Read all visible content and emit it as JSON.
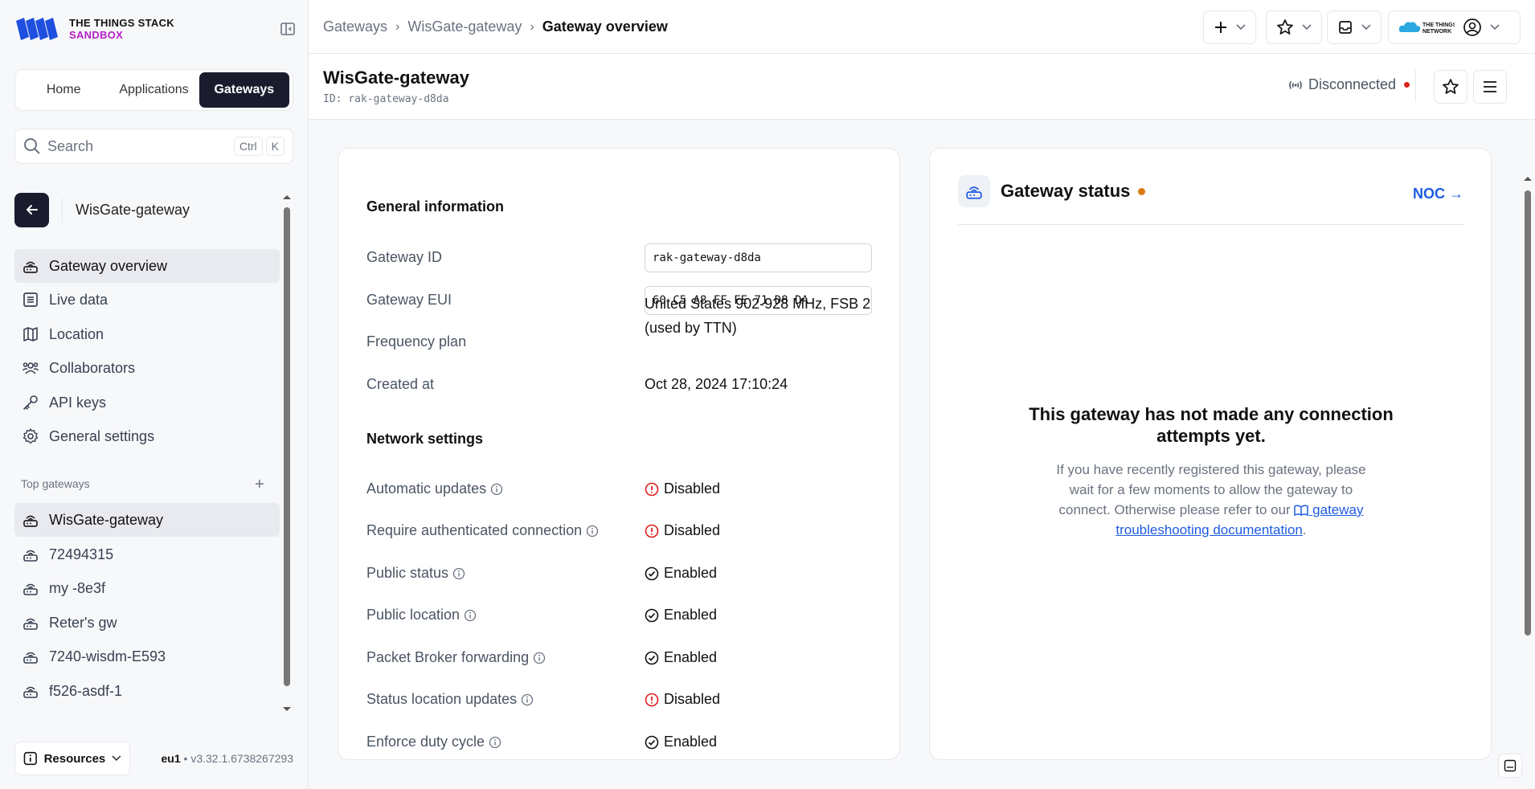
{
  "brand": {
    "line1": "THE THINGS STACK",
    "line2": "SANDBOX",
    "primary_color": "#1e4fe0",
    "accent_color": "#b41ec6"
  },
  "nav": {
    "tabs": [
      {
        "label": "Home",
        "active": false
      },
      {
        "label": "Applications",
        "active": false
      },
      {
        "label": "Gateways",
        "active": true
      }
    ]
  },
  "search": {
    "placeholder": "Search",
    "shortcut_1": "Ctrl",
    "shortcut_2": "K"
  },
  "sidebar": {
    "back_title": "WisGate-gateway",
    "items": [
      {
        "label": "Gateway overview",
        "icon": "gateway-icon",
        "active": true
      },
      {
        "label": "Live data",
        "icon": "list-icon"
      },
      {
        "label": "Location",
        "icon": "map-icon"
      },
      {
        "label": "Collaborators",
        "icon": "users-icon"
      },
      {
        "label": "API keys",
        "icon": "key-icon"
      },
      {
        "label": "General settings",
        "icon": "gear-icon"
      }
    ],
    "top_gateways_label": "Top gateways",
    "top_gateways": [
      {
        "label": "WisGate-gateway",
        "active": true
      },
      {
        "label": "72494315"
      },
      {
        "label": "my -8e3f"
      },
      {
        "label": "Reter's gw"
      },
      {
        "label": "7240-wisdm-E593"
      },
      {
        "label": "f526-asdf-1"
      }
    ],
    "resources_label": "Resources",
    "cluster": "eu1",
    "version": "v3.32.1.6738267293"
  },
  "breadcrumb": {
    "items": [
      "Gateways",
      "WisGate-gateway"
    ],
    "current": "Gateway overview"
  },
  "header": {
    "title": "WisGate-gateway",
    "id_prefix": "ID:",
    "id": "rak-gateway-d8da",
    "connection_status": "Disconnected",
    "disconnected_color": "#e0201b"
  },
  "general_info": {
    "title": "General information",
    "gateway_id_label": "Gateway ID",
    "gateway_id": "rak-gateway-d8da",
    "gateway_eui_label": "Gateway EUI",
    "gateway_eui": "60 C5 A8 FF FE 71 D8 DA",
    "frequency_plan_label": "Frequency plan",
    "frequency_plan": "United States 902-928 MHz, FSB 2 (used by TTN)",
    "created_at_label": "Created at",
    "created_at": "Oct 28, 2024 17:10:24"
  },
  "network_settings": {
    "title": "Network settings",
    "rows": [
      {
        "label": "Automatic updates",
        "value": "Disabled",
        "enabled": false
      },
      {
        "label": "Require authenticated connection",
        "value": "Disabled",
        "enabled": false
      },
      {
        "label": "Public status",
        "value": "Enabled",
        "enabled": true
      },
      {
        "label": "Public location",
        "value": "Enabled",
        "enabled": true
      },
      {
        "label": "Packet Broker forwarding",
        "value": "Enabled",
        "enabled": true
      },
      {
        "label": "Status location updates",
        "value": "Disabled",
        "enabled": false
      },
      {
        "label": "Enforce duty cycle",
        "value": "Enabled",
        "enabled": true
      }
    ]
  },
  "gateway_status": {
    "title": "Gateway status",
    "noc_link": "NOC →",
    "status_dot_color": "#db7a14",
    "empty_title": "This gateway has not made any connection attempts yet.",
    "empty_body": "If you have recently registered this gateway, please wait for a few moments to allow the gateway to connect. Otherwise please refer to our",
    "doc_link": "gateway troubleshooting documentation",
    "doc_link_suffix": "."
  }
}
